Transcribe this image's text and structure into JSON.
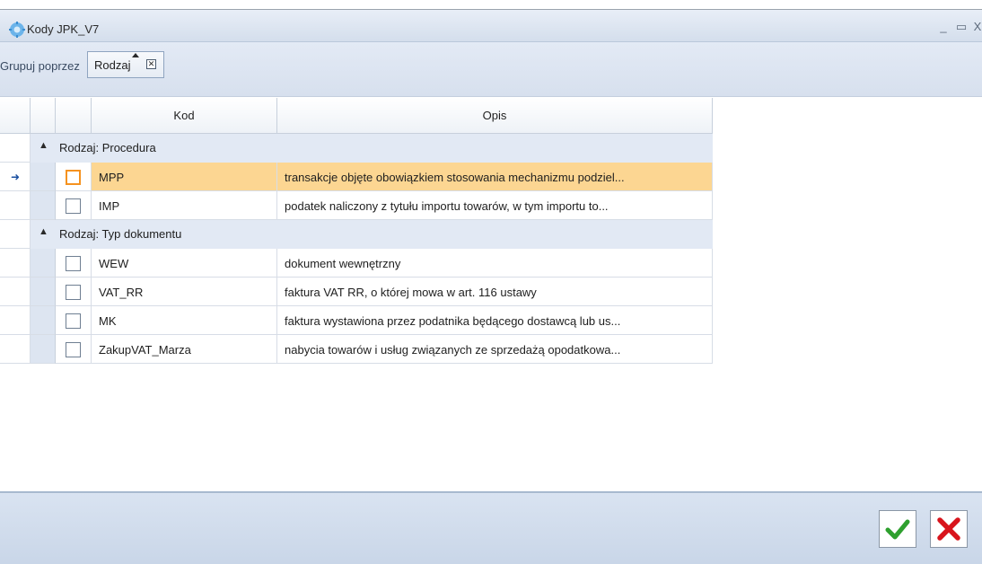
{
  "window": {
    "title": "Kody JPK_V7"
  },
  "groupbar": {
    "hint": "Grupuj poprzez",
    "chip_label": "Rodzaj",
    "chip_close": "✕"
  },
  "grid": {
    "columns": [
      "Kod",
      "Opis"
    ],
    "groups": [
      {
        "label": "Rodzaj: Procedura",
        "rows": [
          {
            "kod": "MPP",
            "opis": "transakcje objęte obowiązkiem stosowania mechanizmu podziel...",
            "selected": true
          },
          {
            "kod": "IMP",
            "opis": "podatek naliczony z tytułu importu towarów, w tym importu to...",
            "selected": false
          }
        ]
      },
      {
        "label": "Rodzaj: Typ dokumentu",
        "rows": [
          {
            "kod": "WEW",
            "opis": "dokument wewnętrzny",
            "selected": false
          },
          {
            "kod": "VAT_RR",
            "opis": "faktura VAT RR, o której mowa w art. 116 ustawy",
            "selected": false
          },
          {
            "kod": "MK",
            "opis": "faktura wystawiona przez podatnika będącego dostawcą lub us...",
            "selected": false
          },
          {
            "kod": "ZakupVAT_Marza",
            "opis": "nabycia towarów i usług związanych ze sprzedażą opodatkowa...",
            "selected": false
          }
        ]
      }
    ]
  },
  "colors": {
    "selected_row": "#fcd692",
    "group_row": "#e2e9f4",
    "ok": "#2ea02e",
    "cancel": "#d8141c"
  }
}
